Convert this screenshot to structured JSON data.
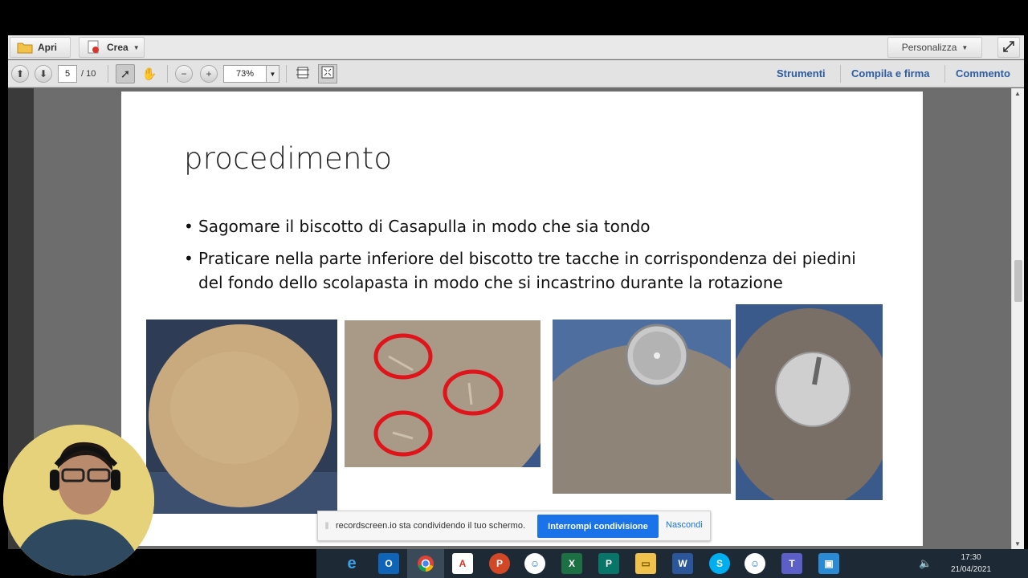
{
  "toolbar": {
    "open_label": "Apri",
    "create_label": "Crea",
    "customize_label": "Personalizza"
  },
  "navigation": {
    "current_page": "5",
    "total_pages": "/ 10",
    "zoom": "73%"
  },
  "panels": {
    "tools": "Strumenti",
    "fill_sign": "Compila e firma",
    "comment": "Commento"
  },
  "slide": {
    "title": "procedimento",
    "bullets": [
      "Sagomare il biscotto di Casapulla in modo che sia tondo",
      "Praticare nella parte inferiore del biscotto tre tacche in corrispondenza dei piedini del fondo dello scolapasta in modo che si incastrino durante la rotazione"
    ]
  },
  "share_banner": {
    "message": "recordscreen.io sta condividendo il tuo schermo.",
    "stop_label": "Interrompi condivisione",
    "hide_label": "Nascondi"
  },
  "taskbar": {
    "time": "17:30",
    "date": "21/04/2021",
    "icons": [
      "edge-icon",
      "outlook-icon",
      "chrome-icon",
      "acrobat-icon",
      "powerpoint-icon",
      "chat-icon",
      "excel-icon",
      "publisher-icon",
      "file-explorer-icon",
      "word-icon",
      "skype-icon",
      "chat-icon",
      "teams-icon",
      "remote-icon"
    ]
  },
  "colors": {
    "link_blue": "#2d5d9f",
    "share_button": "#1a73e8",
    "mark_red": "#e0141b"
  }
}
